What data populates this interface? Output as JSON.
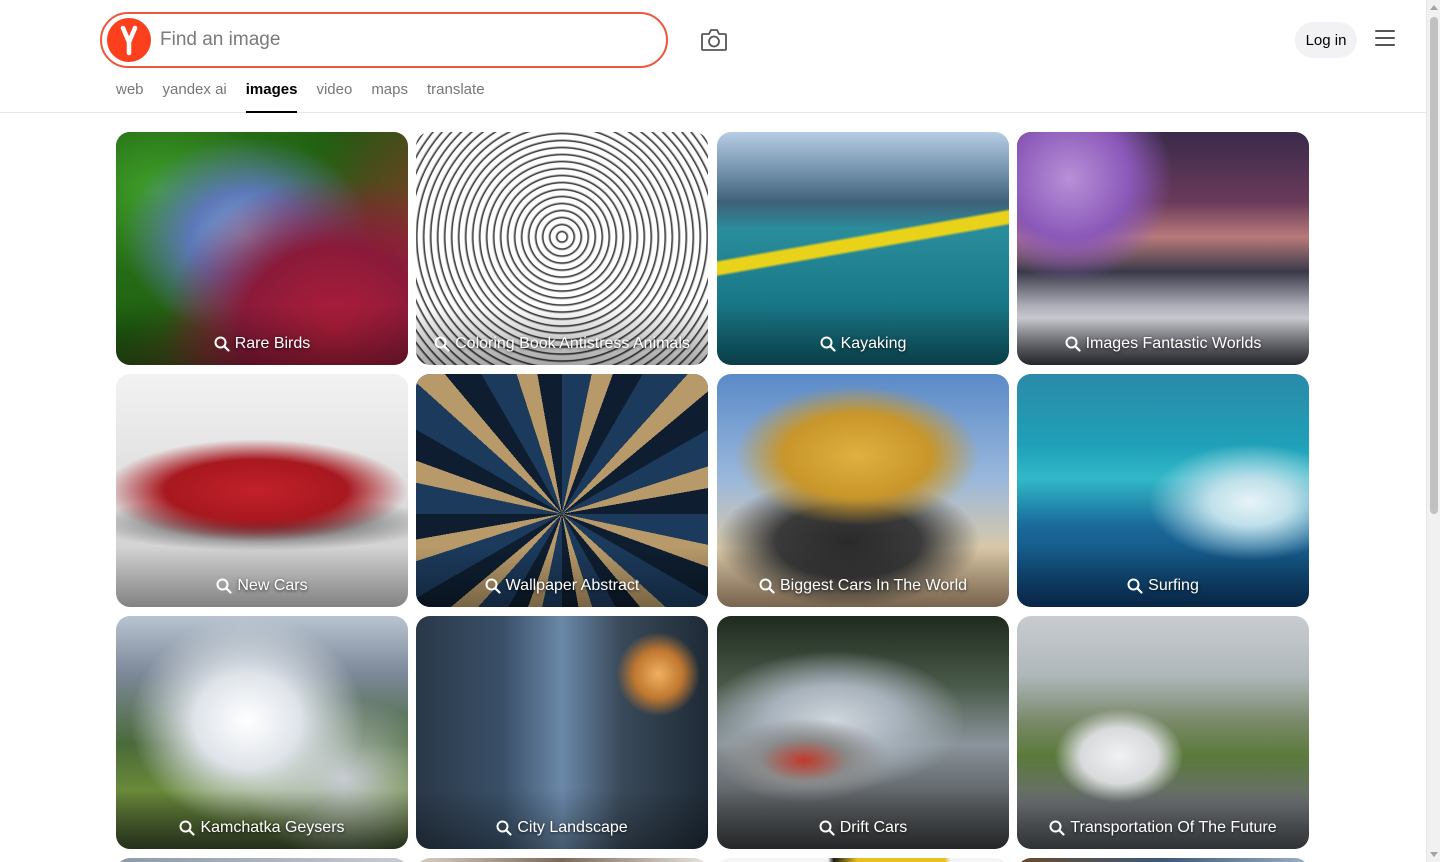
{
  "search": {
    "placeholder": "Find an image",
    "value": ""
  },
  "header": {
    "login_label": "Log in"
  },
  "tabs": [
    {
      "label": "web"
    },
    {
      "label": "yandex ai"
    },
    {
      "label": "images",
      "active": true
    },
    {
      "label": "video"
    },
    {
      "label": "maps"
    },
    {
      "label": "translate"
    }
  ],
  "colors": {
    "accent": "#fc3f1d",
    "search_border": "#f0553b"
  },
  "grid": {
    "cards": [
      {
        "label": "Rare Birds"
      },
      {
        "label": "Coloring Book Antistress Animals"
      },
      {
        "label": "Kayaking"
      },
      {
        "label": "Images Fantastic Worlds"
      },
      {
        "label": "New Cars"
      },
      {
        "label": "Wallpaper Abstract"
      },
      {
        "label": "Biggest Cars In The World"
      },
      {
        "label": "Surfing"
      },
      {
        "label": "Kamchatka Geysers"
      },
      {
        "label": "City Landscape"
      },
      {
        "label": "Drift Cars"
      },
      {
        "label": "Transportation Of The Future"
      }
    ]
  }
}
